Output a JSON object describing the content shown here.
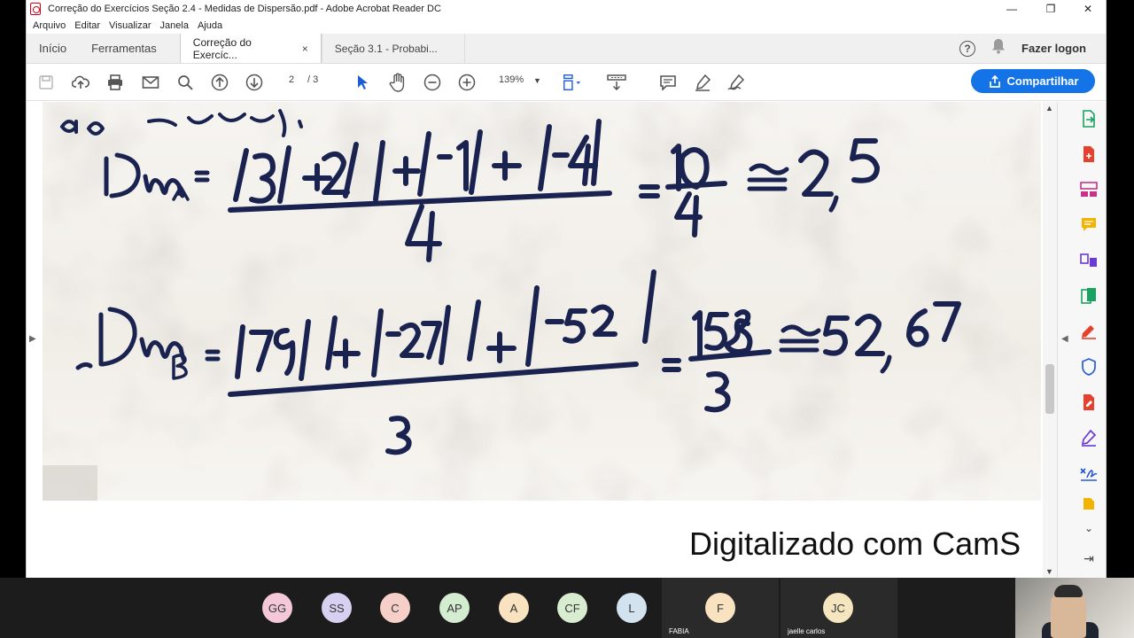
{
  "window": {
    "title": "Correção do Exercícios Seção 2.4 - Medidas de Dispersão.pdf - Adobe Acrobat Reader DC",
    "controls": {
      "minimize": "—",
      "maximize": "❐",
      "close": "✕"
    }
  },
  "menu": [
    "Arquivo",
    "Editar",
    "Visualizar",
    "Janela",
    "Ajuda"
  ],
  "nav_tabs": {
    "home": "Início",
    "tools": "Ferramentas"
  },
  "doc_tabs": [
    {
      "label": "Correção do Exercíc...",
      "close": "×"
    },
    {
      "label": "Seção 3.1 - Probabi..."
    }
  ],
  "header_right": {
    "help": "?",
    "login": "Fazer logon"
  },
  "toolbar": {
    "page_current": "2",
    "page_total": "/  3",
    "zoom": "139%",
    "share_label": "Compartilhar"
  },
  "document": {
    "formula_a": {
      "label": "DmA =",
      "numerator": "|3| + |2| + |-1| + |-4|",
      "denominator": "4",
      "result_frac_num": "10",
      "result_frac_den": "4",
      "approx": "≅ 2,5"
    },
    "formula_b": {
      "label": "DmB =",
      "numerator": "|79| + |-27| + |-52|",
      "denominator": "3",
      "result_frac_num": "158",
      "result_frac_den": "3",
      "approx": "≅ 52,67"
    },
    "header_fragment": "dos desvios).",
    "watermark": "Digitalizado com CamS"
  },
  "participants": [
    {
      "initials": "GG",
      "color": "#f4c8d8"
    },
    {
      "initials": "SS",
      "color": "#d8d0f0"
    },
    {
      "initials": "C",
      "color": "#f6d0c8"
    },
    {
      "initials": "AP",
      "color": "#d4ecd0"
    },
    {
      "initials": "A",
      "color": "#f8e2c0"
    },
    {
      "initials": "CF",
      "color": "#d8ecd0"
    },
    {
      "initials": "L",
      "color": "#d2e2ee"
    },
    {
      "initials": "F",
      "color": "#f8e2c0",
      "name": "FABIA"
    },
    {
      "initials": "JC",
      "color": "#f6e6c0",
      "name": "jaelle carlos"
    }
  ]
}
